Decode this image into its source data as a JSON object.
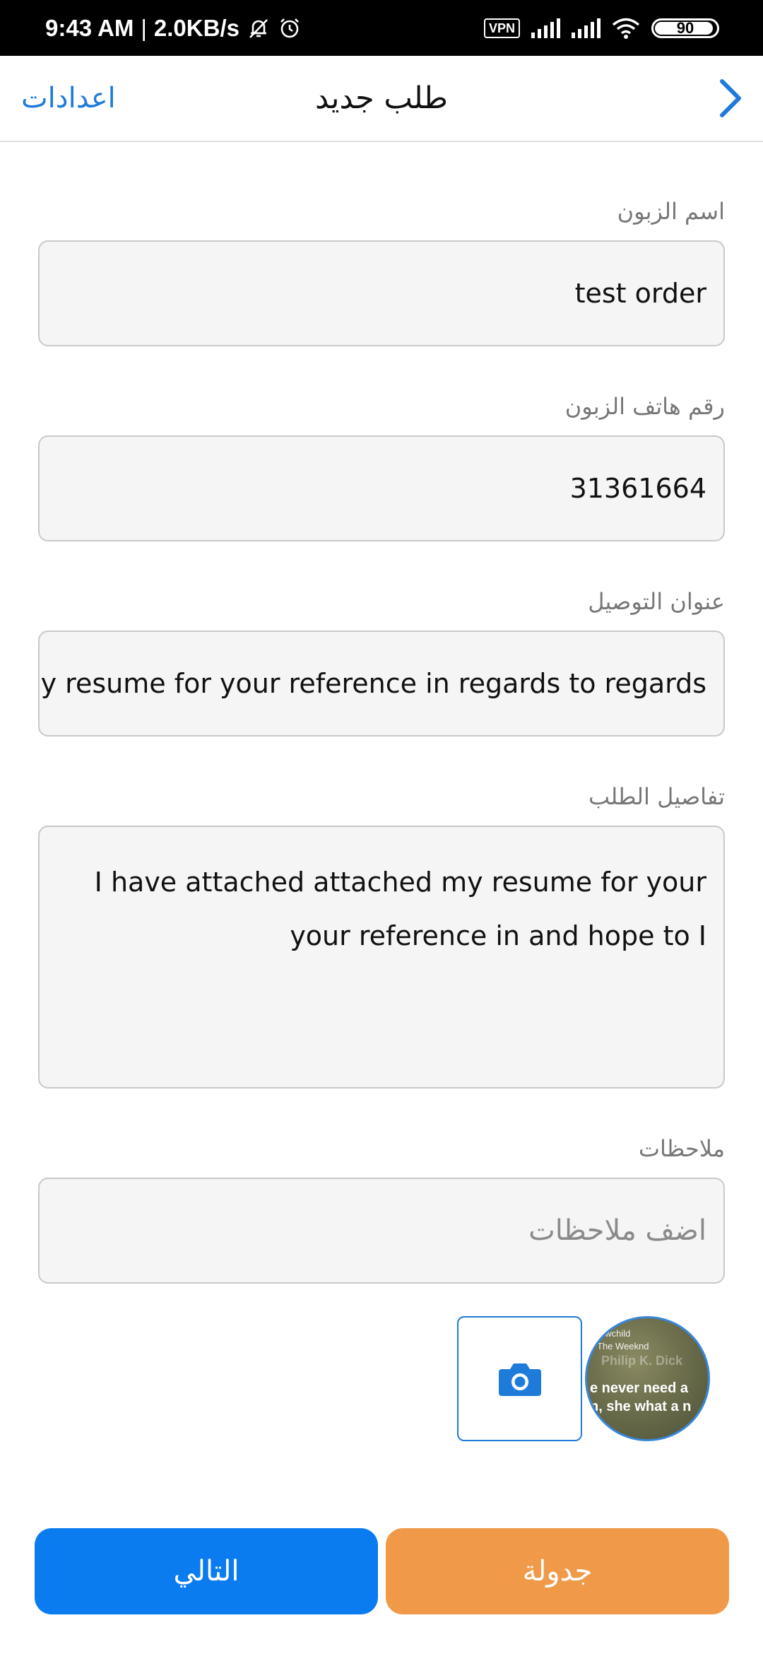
{
  "status_bar": {
    "time": "9:43 AM",
    "separator": "|",
    "net_speed": "2.0KB/s",
    "vpn": "VPN",
    "battery": "90"
  },
  "header": {
    "title": "طلب جديد",
    "settings_label": "اعدادات"
  },
  "form": {
    "customer_name": {
      "label": "اسم الزبون",
      "value": "test order"
    },
    "customer_phone": {
      "label": "رقم هاتف الزبون",
      "value": "31361664"
    },
    "delivery_address": {
      "label": "عنوان التوصيل",
      "value": "hed my resume for your reference in regards to regards"
    },
    "order_details": {
      "label": "تفاصيل الطلب",
      "value": "I have attached attached my resume for your your reference in and hope to I"
    },
    "notes": {
      "label": "ملاحظات",
      "placeholder": "اضف ملاحظات"
    }
  },
  "attachment": {
    "thumb_line1": "owchild",
    "thumb_line2": "The Weeknd",
    "thumb_line3": "Philip K. Dick",
    "thumb_line4": "e never need a",
    "thumb_line5": "n, she what a n"
  },
  "buttons": {
    "next": "التالي",
    "schedule": "جدولة"
  },
  "colors": {
    "accent_blue": "#0a7cf0",
    "accent_orange": "#f09a49",
    "link_blue": "#1e7bd9"
  }
}
